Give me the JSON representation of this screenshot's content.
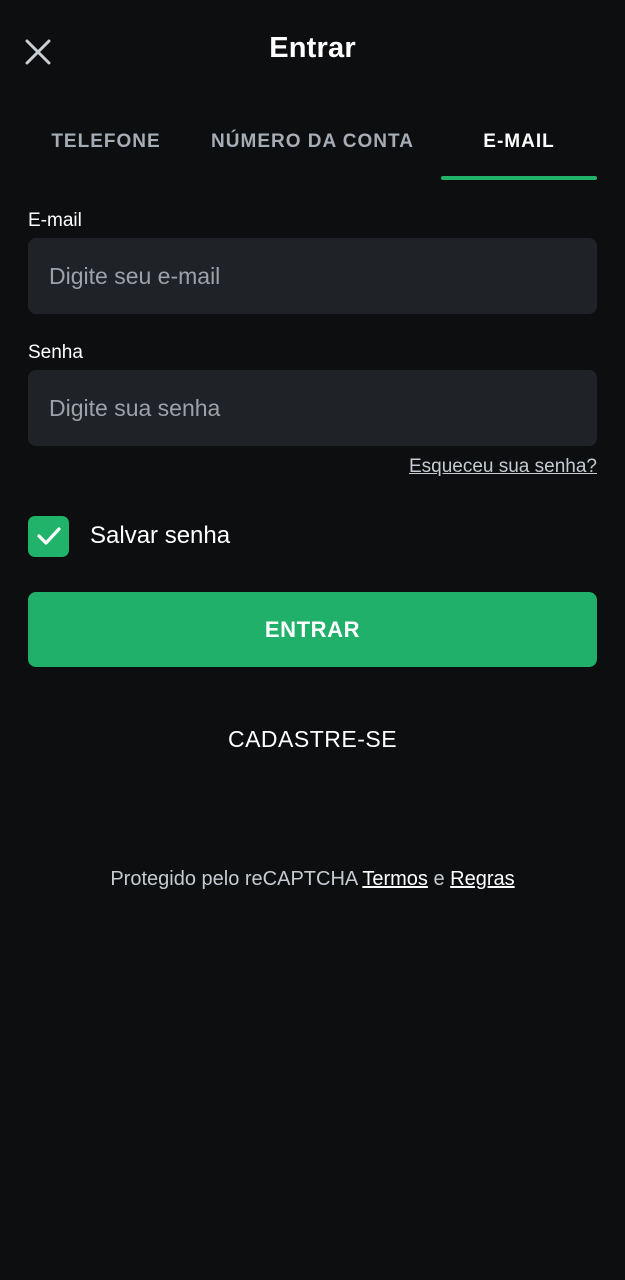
{
  "header": {
    "title": "Entrar",
    "close_icon": "close-icon"
  },
  "tabs": [
    {
      "label": "TELEFONE",
      "active": false
    },
    {
      "label": "NÚMERO DA CONTA",
      "active": false
    },
    {
      "label": "E-MAIL",
      "active": true
    }
  ],
  "form": {
    "email": {
      "label": "E-mail",
      "placeholder": "Digite seu e-mail",
      "value": ""
    },
    "password": {
      "label": "Senha",
      "placeholder": "Digite sua senha",
      "value": ""
    },
    "forgot_link": "Esqueceu sua senha?",
    "save_password": {
      "label": "Salvar senha",
      "checked": true,
      "icon": "checkmark-icon"
    },
    "submit_label": "ENTRAR"
  },
  "register_label": "CADASTRE-SE",
  "footer": {
    "prefix": "Protegido pelo reCAPTCHA",
    "terms_link": "Termos",
    "conjunction": "e",
    "rules_link": "Regras"
  },
  "colors": {
    "background": "#0c0e10",
    "accent": "#22b36b",
    "input_bg": "#1f2327",
    "muted_text": "#a6adb5"
  }
}
